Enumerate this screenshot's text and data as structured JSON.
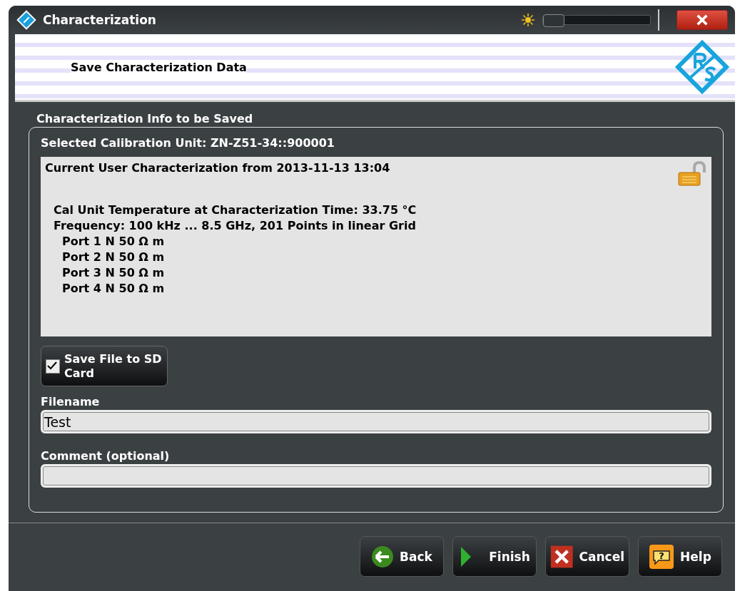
{
  "window": {
    "title": "Characterization",
    "brightness": {
      "level": 0.0
    }
  },
  "banner": {
    "title": "Save Characterization Data"
  },
  "section": {
    "title": "Characterization Info to be Saved",
    "selected_unit": "Selected Calibration Unit: ZN-Z51-34::900001",
    "info": {
      "title": "Current User Characterization from 2013-11-13 13:04",
      "locked": false,
      "lines": [
        {
          "text": "Cal Unit Temperature at Characterization Time: 33.75 °C"
        },
        {
          "text": "Frequency: 100 kHz ... 8.5 GHz, 201 Points in linear Grid",
          "children": [
            {
              "text": "Port 1 N 50 Ω m"
            },
            {
              "text": "Port 2 N 50 Ω m"
            },
            {
              "text": "Port 3 N 50 Ω m"
            },
            {
              "text": "Port 4 N 50 Ω m"
            }
          ]
        }
      ]
    },
    "save_to_sd": {
      "label": "Save File to SD Card",
      "checked": true
    },
    "fields": [
      {
        "label": "Filename",
        "value": "Test"
      },
      {
        "label": "Comment (optional)"
      }
    ]
  },
  "buttons": [
    {
      "kind": "back",
      "label": "Back"
    },
    {
      "kind": "finish",
      "label": "Finish"
    },
    {
      "kind": "cancel",
      "label": "Cancel"
    },
    {
      "kind": "help",
      "label": "Help",
      "glyph": "?"
    }
  ]
}
